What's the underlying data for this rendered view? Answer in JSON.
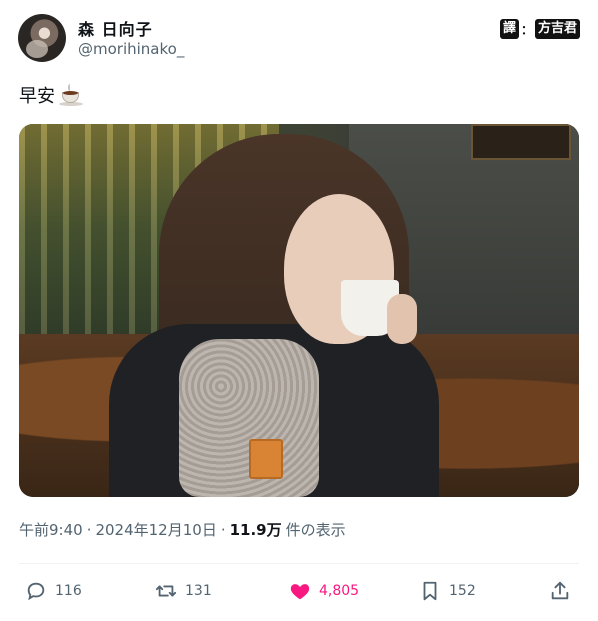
{
  "user": {
    "display_name": "森 日向子",
    "handle": "@morihinako_"
  },
  "watermark": {
    "left": "譯",
    "sep": "：",
    "right": "方吉君"
  },
  "tweet": {
    "text": "早安",
    "emoji_icon": "coffee-icon"
  },
  "meta": {
    "time": "午前9:40",
    "sep1": "·",
    "date": "2024年12月10日",
    "sep2": "·",
    "views": "11.9万",
    "views_suffix": "件の表示"
  },
  "actions": {
    "replies": "116",
    "retweets": "131",
    "likes": "4,805",
    "bookmarks": "152"
  },
  "colors": {
    "like": "#f91880",
    "muted": "#536471",
    "text": "#0f1419"
  }
}
